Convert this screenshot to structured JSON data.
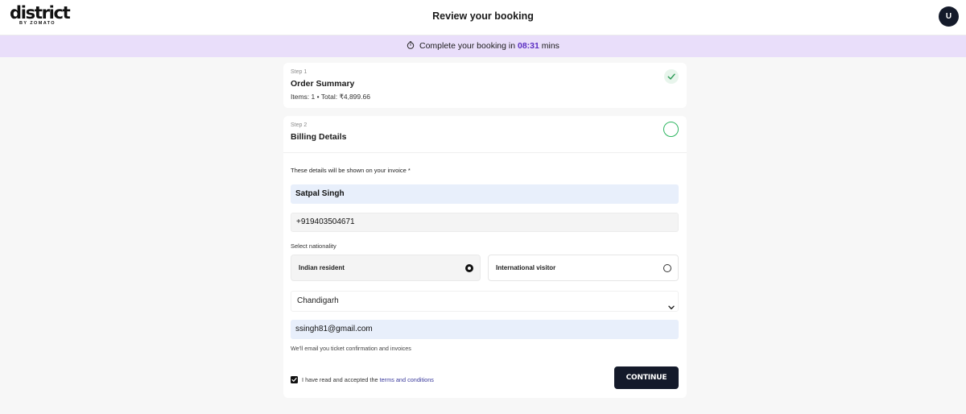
{
  "header": {
    "logo": "district",
    "logo_sub": "BY ZOMATO",
    "title": "Review your booking",
    "avatar_initial": "U"
  },
  "banner": {
    "prefix": "Complete your booking in",
    "time": "08:31",
    "suffix": "mins",
    "icon": "timer-icon"
  },
  "order_summary": {
    "step_label": "Step 1",
    "title": "Order Summary",
    "items_line": "Items: 1 • Total: ₹4,899.66",
    "status_icon": "checkmark-icon"
  },
  "billing": {
    "step_label": "Step 2",
    "title": "Billing Details",
    "invoice_note": "These details will be shown on your invoice *",
    "name_value": "Satpal Singh",
    "phone_value": "+919403504671",
    "nationality_label": "Select nationality",
    "options": [
      {
        "label": "Indian resident",
        "selected": true
      },
      {
        "label": "International visitor",
        "selected": false
      }
    ],
    "state_value": "Chandigarh",
    "email_value": "ssingh81@gmail.com",
    "email_hint": "We'll email you ticket confirmation and invoices",
    "terms_prefix": "I have read and accepted the",
    "terms_link": "terms and conditions",
    "terms_checked": true,
    "continue_label": "CONTINUE"
  },
  "colors": {
    "banner_bg": "#e9defa",
    "timer_accent": "#5b2fc2",
    "primary_dark": "#141a2a",
    "success_green": "#2db560"
  }
}
